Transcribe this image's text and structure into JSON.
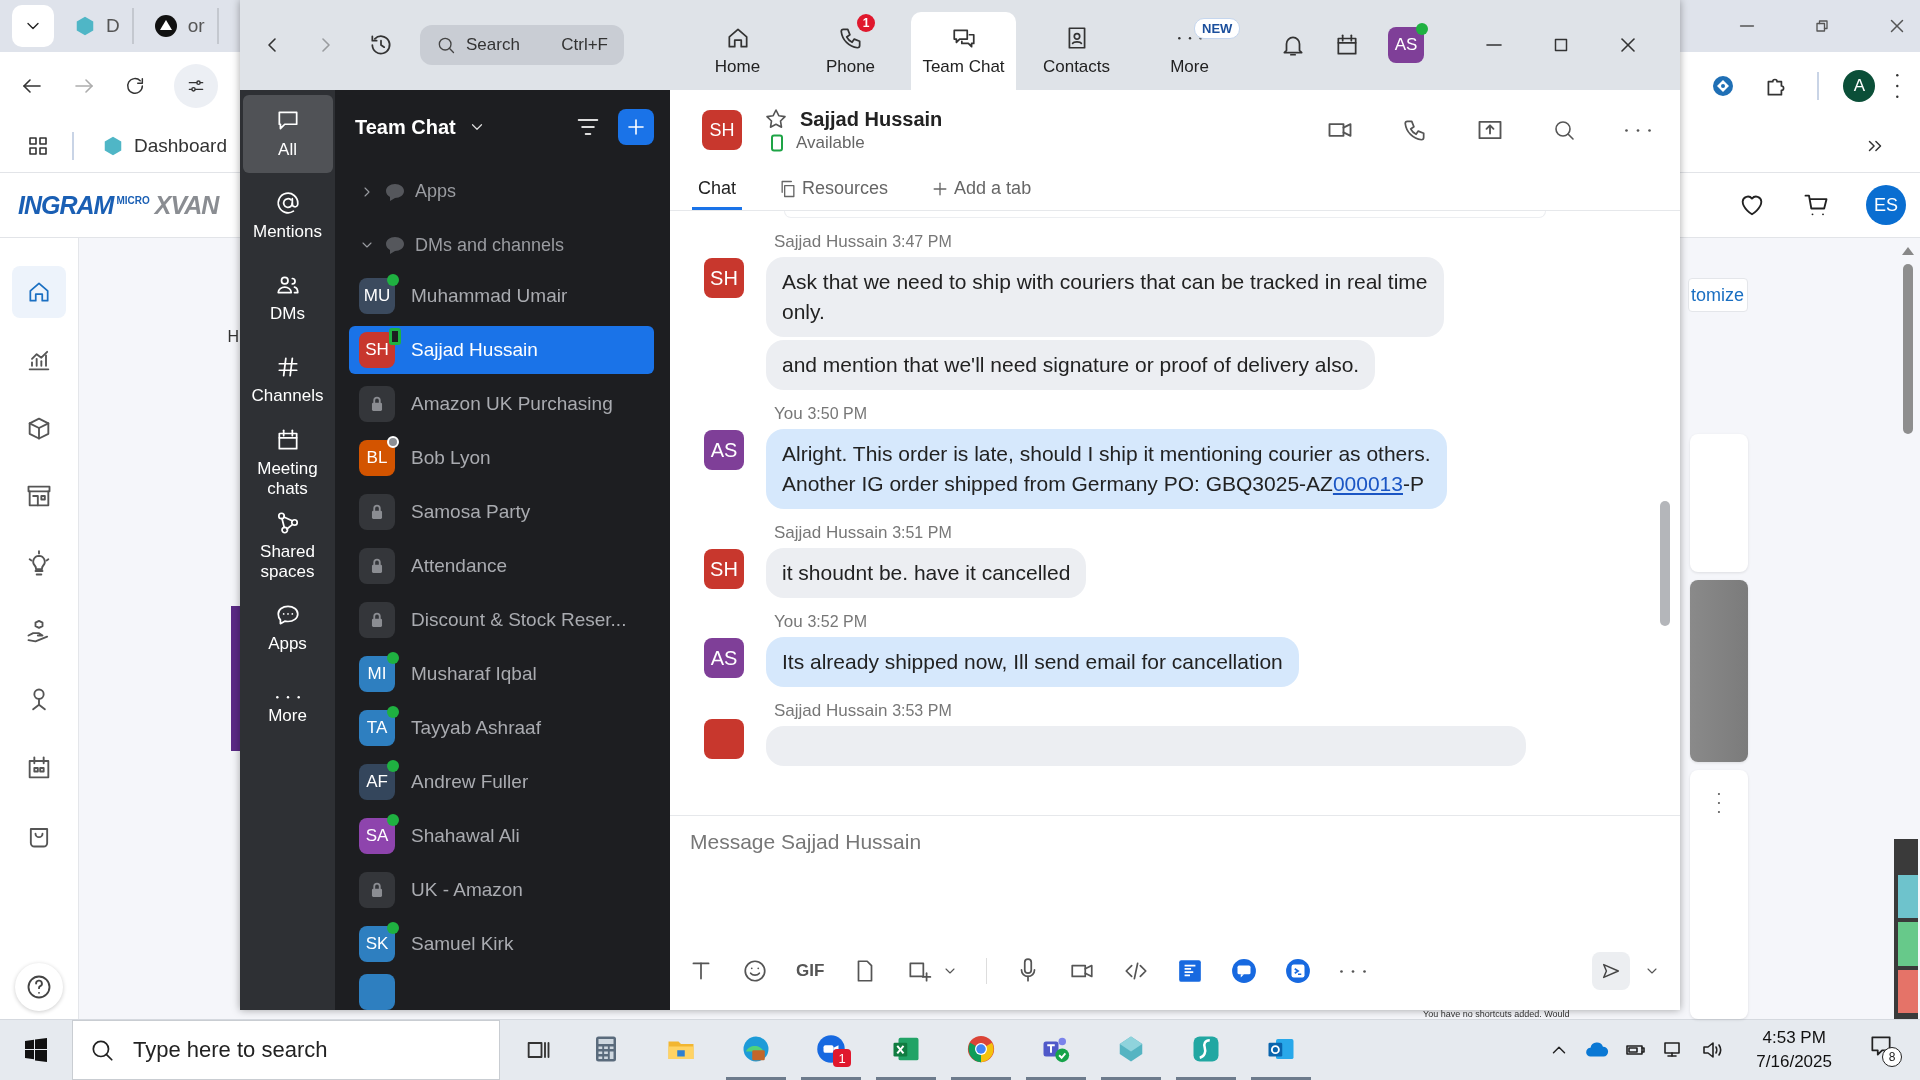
{
  "browser": {
    "tabs": [
      {
        "label": "D",
        "selected": false
      },
      {
        "label": "or",
        "selected": false
      }
    ],
    "profile": "A",
    "bookmarks": [
      {
        "label": "Dashboard"
      }
    ],
    "site": {
      "brand": "INGRAM",
      "brand_small": "MICRO",
      "product": "XVAN",
      "avatar": "ES",
      "page_heading": "H",
      "customize": "tomize",
      "shortcuts_note": "You have no shortcuts added. Would"
    }
  },
  "zoom": {
    "search": {
      "placeholder": "Search",
      "shortcut": "Ctrl+F"
    },
    "tabs": [
      {
        "label": "Home",
        "selected": false
      },
      {
        "label": "Phone",
        "selected": false,
        "badge": {
          "kind": "count",
          "text": "1"
        }
      },
      {
        "label": "Team Chat",
        "selected": true
      },
      {
        "label": "Contacts",
        "selected": false
      },
      {
        "label": "More",
        "selected": false,
        "badge": {
          "kind": "label",
          "text": "NEW"
        }
      }
    ],
    "user": {
      "initials": "AS",
      "color": "#7f3f98",
      "online": true
    },
    "rail": [
      {
        "label": "All",
        "selected": true
      },
      {
        "label": "Mentions",
        "selected": false
      },
      {
        "label": "DMs",
        "selected": false
      },
      {
        "label": "Channels",
        "selected": false
      },
      {
        "label": "Meeting chats",
        "selected": false
      },
      {
        "label": "Shared spaces",
        "selected": false
      },
      {
        "label": "Apps",
        "selected": false
      },
      {
        "label": "More",
        "selected": false
      }
    ],
    "list": {
      "title": "Team Chat",
      "sections": [
        {
          "label": "Apps",
          "expanded": false
        },
        {
          "label": "DMs and channels",
          "expanded": true,
          "children": [
            {
              "kind": "person",
              "name": "Muhammad Umair",
              "initials": "MU",
              "color": "#3b4a5e",
              "online": true,
              "away": false,
              "mobile": false,
              "selected": false
            },
            {
              "kind": "person",
              "name": "Sajjad Hussain",
              "initials": "SH",
              "color": "#c8372d",
              "online": false,
              "away": false,
              "mobile": true,
              "selected": true
            },
            {
              "kind": "channel",
              "name": "Amazon UK Purchasing",
              "selected": false
            },
            {
              "kind": "person",
              "name": "Bob Lyon",
              "initials": "BL",
              "color": "#d35400",
              "online": false,
              "away": true,
              "mobile": false,
              "selected": false
            },
            {
              "kind": "channel",
              "name": "Samosa Party",
              "selected": false
            },
            {
              "kind": "channel",
              "name": "Attendance",
              "selected": false
            },
            {
              "kind": "channel",
              "name": "Discount & Stock Reser...",
              "selected": false
            },
            {
              "kind": "person",
              "name": "Musharaf Iqbal",
              "initials": "MI",
              "color": "#2e7fc0",
              "online": true,
              "away": false,
              "mobile": false,
              "selected": false
            },
            {
              "kind": "person",
              "name": "Tayyab Ashraaf",
              "initials": "TA",
              "color": "#2e7fc0",
              "online": true,
              "away": false,
              "mobile": false,
              "selected": false
            },
            {
              "kind": "person",
              "name": "Andrew Fuller",
              "initials": "AF",
              "color": "#34465c",
              "online": true,
              "away": false,
              "mobile": false,
              "selected": false
            },
            {
              "kind": "person",
              "name": "Shahawal Ali",
              "initials": "SA",
              "color": "#8e44ad",
              "online": true,
              "away": false,
              "mobile": false,
              "selected": false
            },
            {
              "kind": "channel",
              "name": "UK - Amazon",
              "selected": false
            },
            {
              "kind": "person",
              "name": "Samuel Kirk",
              "initials": "SK",
              "color": "#2e7fc0",
              "online": true,
              "away": false,
              "mobile": false,
              "selected": false
            }
          ]
        }
      ]
    },
    "chat": {
      "initials": "SH",
      "color": "#c8372d",
      "name": "Sajjad Hussain",
      "starred": false,
      "status": "Available",
      "tabs": [
        {
          "label": "Chat",
          "selected": true
        },
        {
          "label": "Resources",
          "selected": false
        },
        {
          "label": "Add a tab",
          "selected": false
        }
      ],
      "messages": [
        {
          "sender": "Sajjad Hussain",
          "time": "3:47 PM",
          "mine": false,
          "initials": "SH",
          "color": "#c8372d",
          "bubbles": [
            {
              "segments": [
                {
                  "text": "Ask that we need to ship with couriers that can be tracked in real time\nonly."
                }
              ]
            },
            {
              "segments": [
                {
                  "text": "and mention that we'll need signature or proof of delivery also."
                }
              ]
            }
          ]
        },
        {
          "sender": "You",
          "time": "3:50 PM",
          "mine": true,
          "initials": "AS",
          "color": "#7f3f98",
          "bubbles": [
            {
              "segments": [
                {
                  "text": "Alright. This order is late, should I ship it mentioning courier as others.\nAnother IG order shipped from Germany PO: GBQ3025-AZ"
                },
                {
                  "text": "000013",
                  "link": true
                },
                {
                  "text": "-P"
                }
              ]
            }
          ]
        },
        {
          "sender": "Sajjad Hussain",
          "time": "3:51 PM",
          "mine": false,
          "initials": "SH",
          "color": "#c8372d",
          "bubbles": [
            {
              "segments": [
                {
                  "text": "it shoudnt be. have it cancelled"
                }
              ]
            }
          ]
        },
        {
          "sender": "You",
          "time": "3:52 PM",
          "mine": true,
          "initials": "AS",
          "color": "#7f3f98",
          "bubbles": [
            {
              "segments": [
                {
                  "text": "Its already shipped now, Ill send email for cancellation"
                }
              ]
            }
          ]
        },
        {
          "sender": "Sajjad Hussain",
          "time": "3:53 PM",
          "mine": false,
          "color": "#c8372d",
          "partial": true
        }
      ],
      "composer": {
        "placeholder": "Message Sajjad Hussain",
        "gif": "GIF"
      }
    }
  },
  "taskbar": {
    "search": "Type here to search",
    "time": "4:53 PM",
    "date": "7/16/2025",
    "notifications": "8",
    "apps": [
      {
        "running": false
      },
      {
        "running": false
      },
      {
        "running": true
      },
      {
        "running": true,
        "badge": "1"
      },
      {
        "running": true
      },
      {
        "running": true
      },
      {
        "running": true
      },
      {
        "running": true
      },
      {
        "running": true
      },
      {
        "running": true
      }
    ]
  }
}
